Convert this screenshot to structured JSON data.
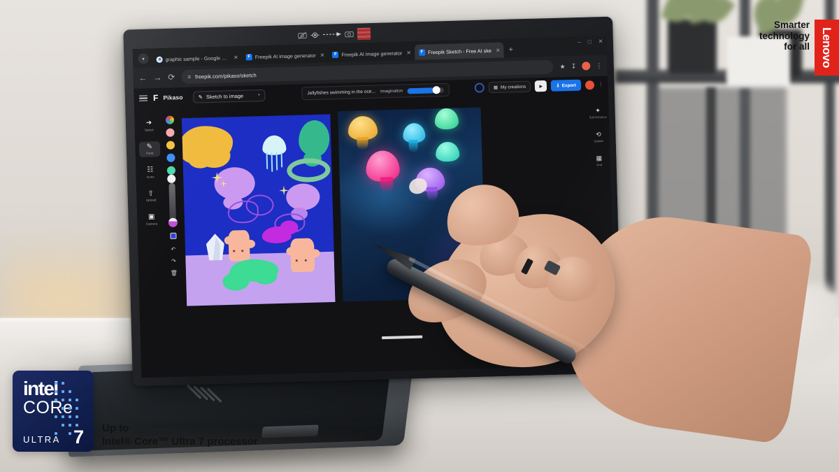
{
  "scene": {
    "description": "Hand using a stylus on a Lenovo convertible laptop running Freepik Pikaso sketch-to-image in a Chrome browser"
  },
  "browser": {
    "tabs": [
      {
        "title": "graphic sample - Google Sear",
        "favicon": "google-icon",
        "active": false
      },
      {
        "title": "Freepik AI image generator",
        "favicon": "freepik-icon",
        "active": false
      },
      {
        "title": "Freepik AI image generator",
        "favicon": "freepik-icon",
        "active": false
      },
      {
        "title": "Freepik Sketch - Free AI ske",
        "favicon": "freepik-icon",
        "active": true
      }
    ],
    "new_tab_label": "+",
    "window_controls": [
      "minimize",
      "maximize",
      "close"
    ],
    "nav": {
      "back": "back-icon",
      "forward": "forward-icon",
      "reload": "reload-icon"
    },
    "omnibox": {
      "value": "freepik.com/pikaso/sketch",
      "icon": "tune-icon"
    },
    "toolbar_icons": [
      "bookmark-star-icon",
      "downloads-icon",
      "profile-avatar",
      "menu-kebab-icon"
    ]
  },
  "app": {
    "brand": "Pikaso",
    "logo_glyph": "F",
    "mode_select": {
      "label": "Sketch to image",
      "icon": "magic-wand-icon",
      "caret": "▾"
    },
    "prompt": {
      "value": "Jellyfishes swimming in the oce...",
      "imagination_label": "Imagination",
      "imagination_value": 74
    },
    "actions": {
      "my_creations": "My creations",
      "my_creations_icon": "gallery-icon",
      "play_icon": "play-icon",
      "export": "Export",
      "export_icon": "download-icon"
    },
    "tools": [
      {
        "label": "Select",
        "icon": "cursor-icon",
        "active": false
      },
      {
        "label": "Paint",
        "icon": "brush-icon",
        "active": true
      },
      {
        "label": "Icons",
        "icon": "shapes-icon",
        "active": false
      },
      {
        "label": "Upload",
        "icon": "upload-icon",
        "active": false
      },
      {
        "label": "Camera",
        "icon": "camera-icon",
        "active": false
      }
    ],
    "palette": {
      "swatches": [
        {
          "name": "color-wheel",
          "color": "rainbow"
        },
        {
          "name": "pink",
          "color": "#f4a8b0"
        },
        {
          "name": "yellow",
          "color": "#f5c241"
        },
        {
          "name": "blue",
          "color": "#3d8ef7"
        },
        {
          "name": "mint",
          "color": "#4ed9a8"
        }
      ],
      "active_color": "#ffffff",
      "brush_size_handle_color": "#c44cd9"
    },
    "history": [
      {
        "name": "layers-icon"
      },
      {
        "name": "undo-icon"
      },
      {
        "name": "redo-icon"
      },
      {
        "name": "trash-icon"
      }
    ],
    "right_rail": [
      {
        "label": "Soft\nEnhance",
        "icon": "wand-icon"
      },
      {
        "label": "Update",
        "icon": "refresh-icon"
      },
      {
        "label": "Grid",
        "icon": "grid-icon"
      }
    ]
  },
  "canvas": {
    "sketch_title": "sketch-canvas",
    "sketch_background": "#1c2ec4",
    "sand_color": "#c4a2ef",
    "result_title": "ai-result-canvas",
    "result_background": "#0d2142",
    "jellyfish_colors": [
      "#f5c241",
      "#ff3d8f",
      "#2fd6f0",
      "#3ce8a0",
      "#34e0b8",
      "#b46ff0"
    ]
  },
  "bezel": {
    "shutter_icons": [
      "camera-off-icon",
      "dial-icon",
      "arrow-icon",
      "camera-on-icon"
    ],
    "sticker": "red-warning-sticker"
  },
  "intel": {
    "brand": "intel",
    "core": "CORe",
    "tier": "ULTRA",
    "number": "7",
    "caption_line1": "Up to",
    "caption_line2": "Intel® Core™ Ultra 7 processor",
    "badge_color": "#132252"
  },
  "lenovo": {
    "tagline_line1": "Smarter",
    "tagline_line2": "technology",
    "tagline_line3": "for all",
    "brand": "Lenovo",
    "brand_color": "#e2231a"
  }
}
